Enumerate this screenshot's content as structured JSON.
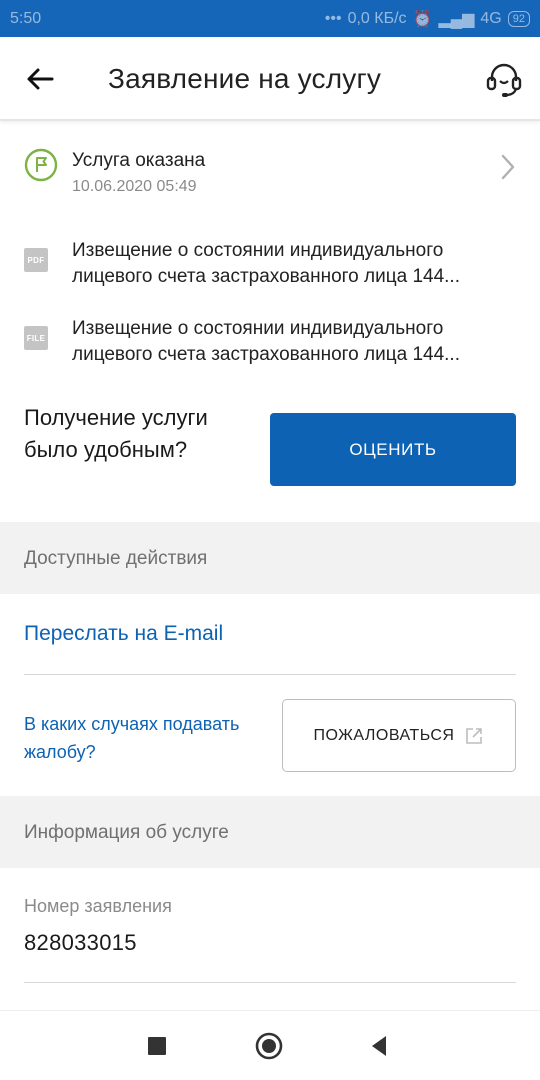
{
  "status_bar": {
    "time": "5:50",
    "network_speed": "0,0 КБ/с",
    "signal": "4G",
    "battery": "92"
  },
  "header": {
    "title": "Заявление на услугу"
  },
  "service_status": {
    "title": "Услуга оказана",
    "date": "10.06.2020 05:49"
  },
  "documents": [
    {
      "type": "PDF",
      "line1": "Извещение о состоянии индивидуального",
      "line2": "лицевого счета застрахованного лица 144..."
    },
    {
      "type": "FILE",
      "line1": "Извещение о состоянии индивидуального",
      "line2": "лицевого счета застрахованного лица 144..."
    }
  ],
  "rating": {
    "question": "Получение услуги было удобным?",
    "button_label": "ОЦЕНИТЬ"
  },
  "actions_section": {
    "title": "Доступные действия",
    "forward_link": "Переслать на E-mail",
    "complaint_info_link": "В каких случаях подавать жалобу?",
    "complain_button": "ПОЖАЛОВАТЬСЯ"
  },
  "info_section": {
    "title": "Информация об услуге",
    "application_number_label": "Номер заявления",
    "application_number": "828033015"
  },
  "colors": {
    "status_bar": "#1565b8",
    "primary": "#0d62b3",
    "success_green": "#7cb342",
    "section_bg": "#f2f2f2"
  },
  "icons": {
    "back": "arrow-left-icon",
    "support": "headset-icon",
    "status": "flag-icon",
    "chevron": "chevron-right-icon",
    "external": "external-link-icon"
  }
}
